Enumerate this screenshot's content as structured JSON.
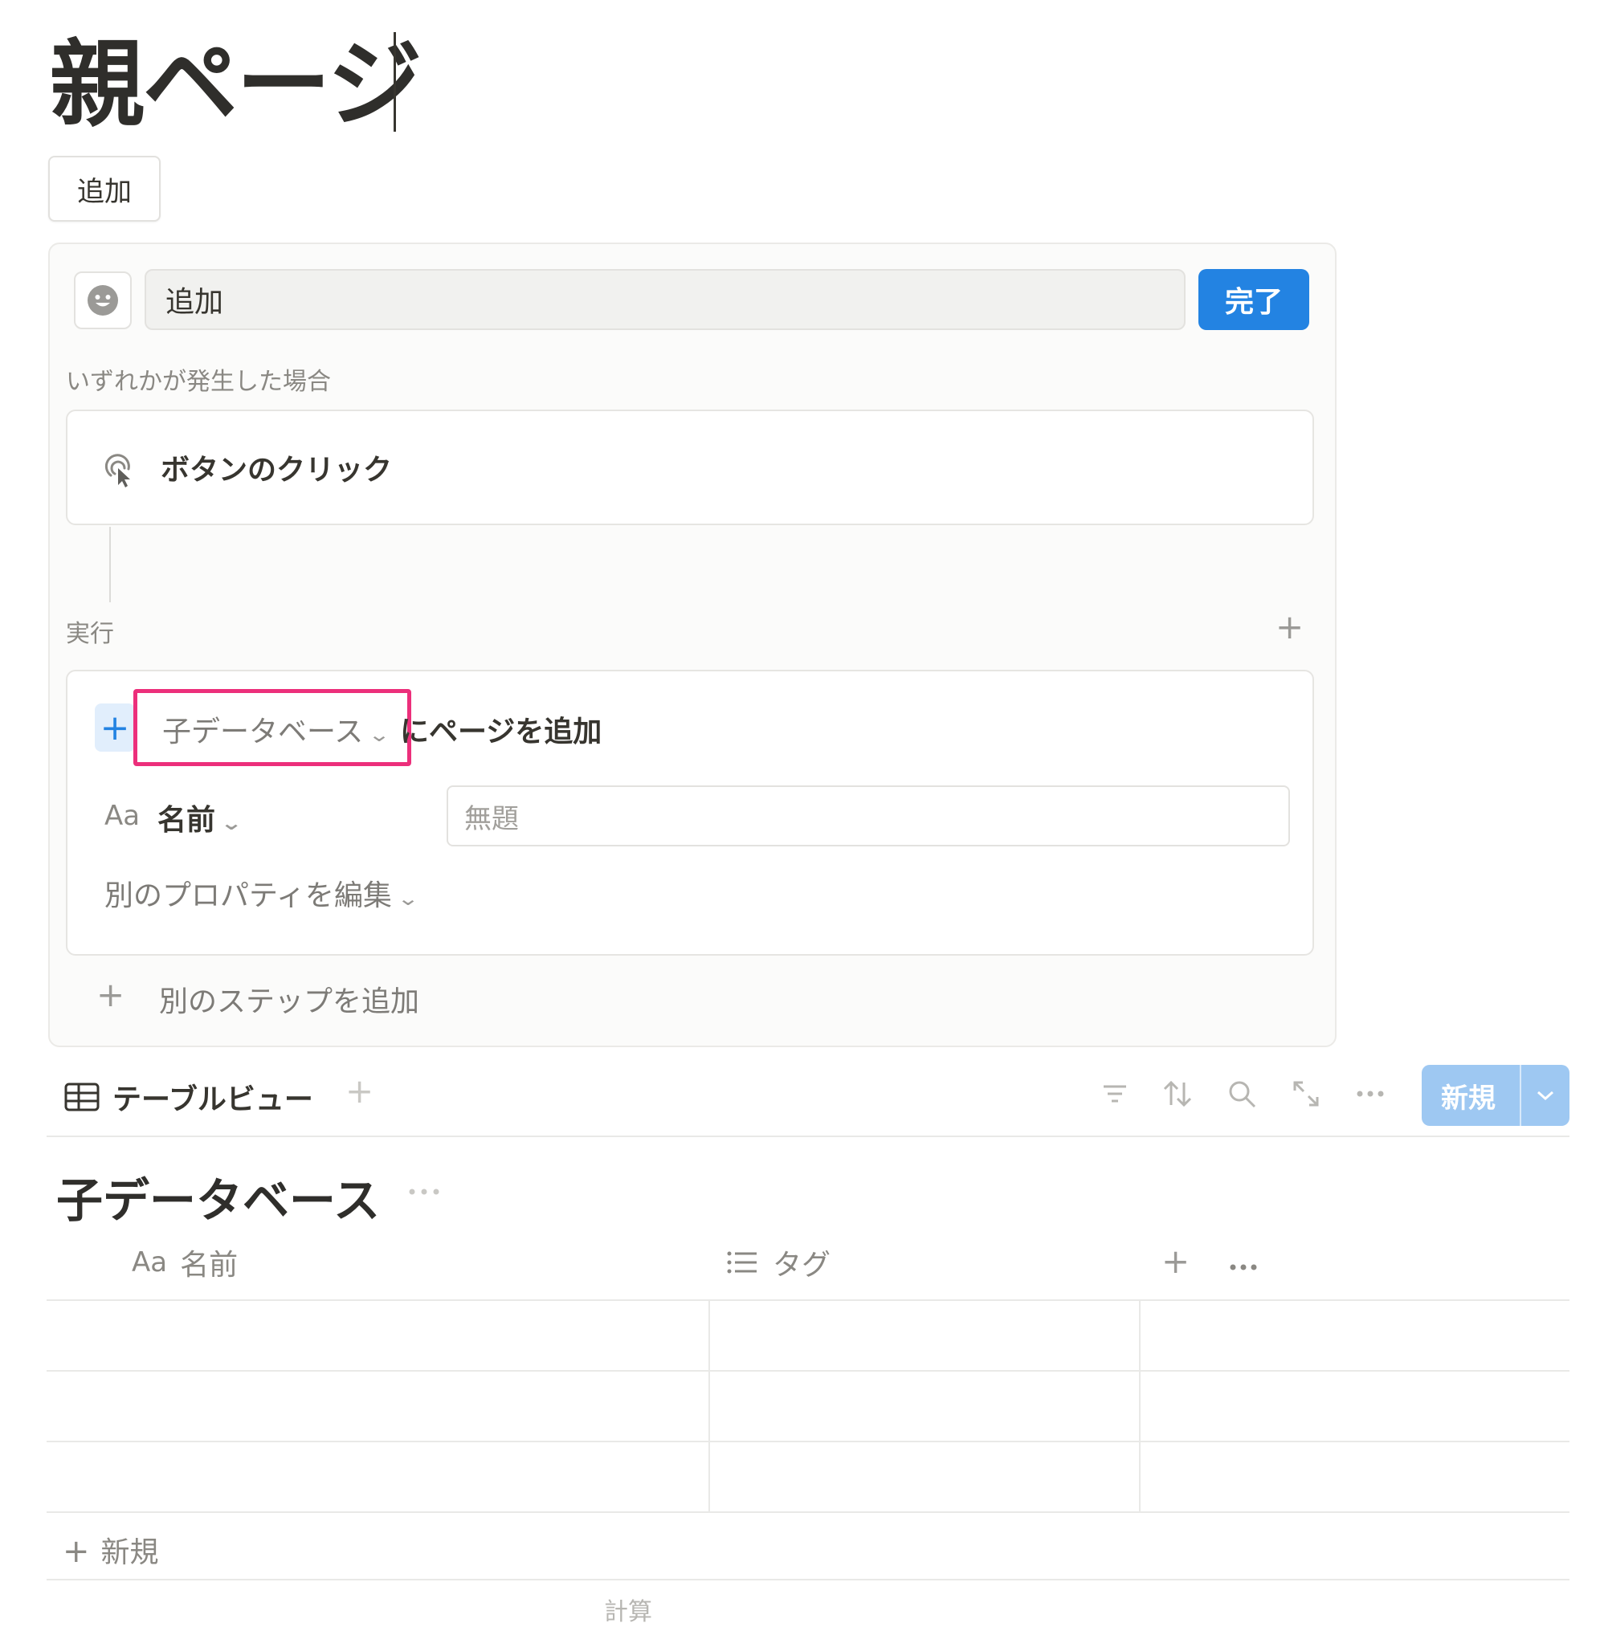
{
  "page": {
    "title": "親ページ",
    "top_button_label": "追加"
  },
  "editor": {
    "button_name_value": "追加",
    "done_label": "完了",
    "trigger_section_label": "いずれかが発生した場合",
    "trigger_label": "ボタンのクリック",
    "action_section_label": "実行",
    "action": {
      "database_select": "子データベース",
      "action_suffix": "にページを追加",
      "property_prefix": "Aa",
      "property_name": "名前",
      "property_placeholder": "無題",
      "edit_properties_label": "別のプロパティを編集"
    },
    "add_step_label": "別のステップを追加"
  },
  "database": {
    "view_tab_label": "テーブルビュー",
    "new_button_label": "新規",
    "title": "子データベース",
    "columns": [
      {
        "prefix": "Aa",
        "label": "名前"
      },
      {
        "prefix": "",
        "label": "タグ"
      }
    ],
    "rows": [
      {
        "name": "",
        "tags": ""
      },
      {
        "name": "",
        "tags": ""
      },
      {
        "name": "",
        "tags": ""
      }
    ],
    "new_row_label": "新規",
    "count_label": "計算"
  },
  "colors": {
    "accent": "#2383e2",
    "highlight": "#ec2f7b",
    "new_button": "#9ec8f2"
  }
}
